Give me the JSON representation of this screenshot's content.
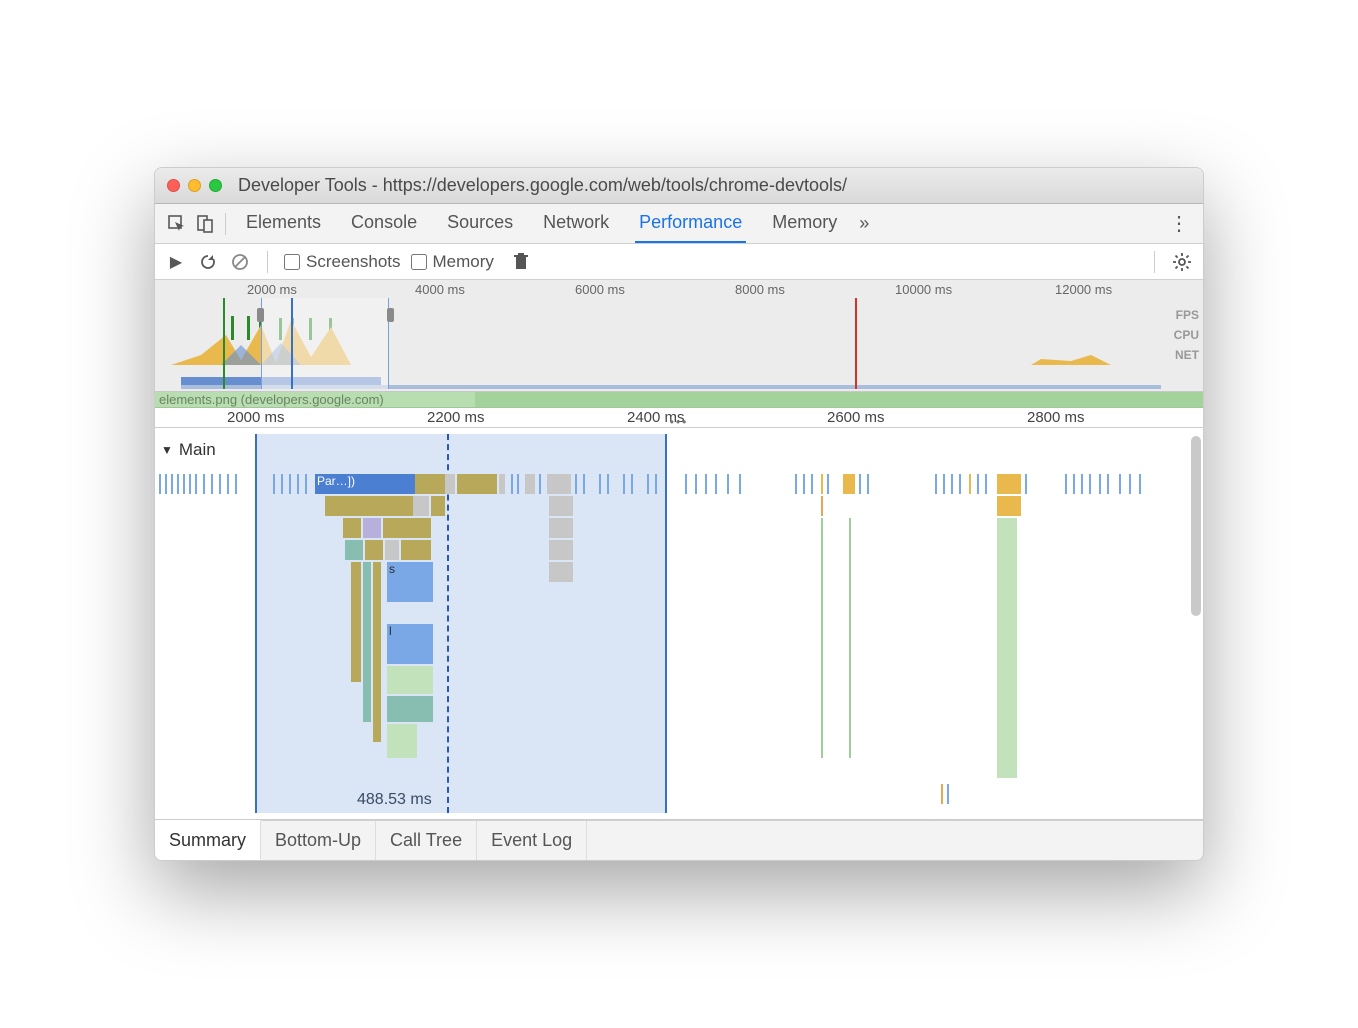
{
  "window": {
    "title": "Developer Tools - https://developers.google.com/web/tools/chrome-devtools/"
  },
  "tabs": {
    "items": [
      "Elements",
      "Console",
      "Sources",
      "Network",
      "Performance",
      "Memory"
    ],
    "active": "Performance"
  },
  "toolbar": {
    "screenshots_label": "Screenshots",
    "memory_label": "Memory"
  },
  "overview": {
    "ticks": [
      "2000 ms",
      "4000 ms",
      "6000 ms",
      "8000 ms",
      "10000 ms",
      "12000 ms"
    ],
    "lanes": [
      "FPS",
      "CPU",
      "NET"
    ]
  },
  "midruler": {
    "frames_label": "elements.png (developers.google.com)",
    "ticks": [
      "2000 ms",
      "2200 ms",
      "2400 ms",
      "2600 ms",
      "2800 ms"
    ]
  },
  "flame": {
    "section_label": "Main",
    "task_label": "Par…])",
    "stack_label_s": "s",
    "stack_label_l": "l",
    "selection_time": "488.53 ms"
  },
  "details_tabs": {
    "items": [
      "Summary",
      "Bottom-Up",
      "Call Tree",
      "Event Log"
    ],
    "active": "Summary"
  }
}
